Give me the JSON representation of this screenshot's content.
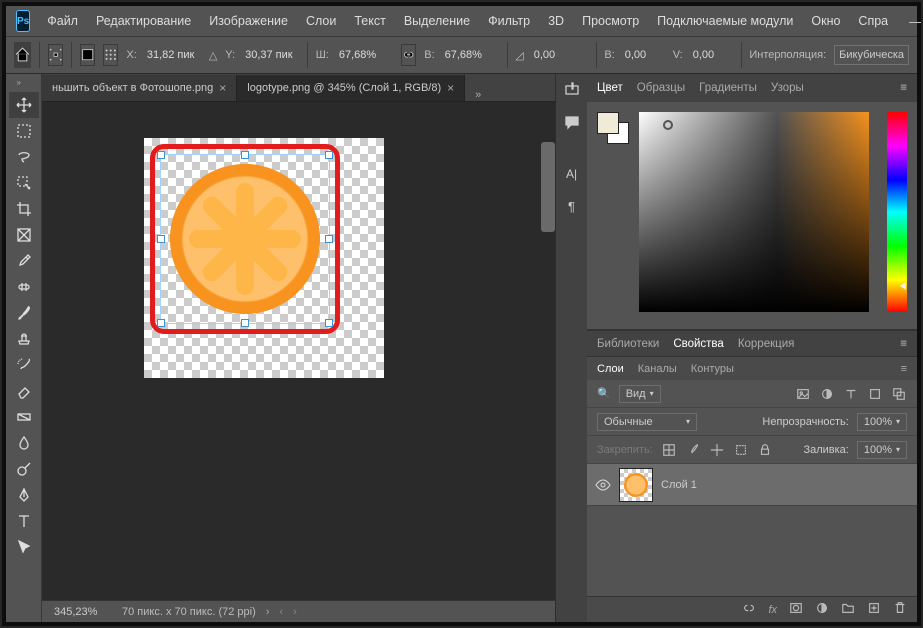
{
  "menu": [
    "Файл",
    "Редактирование",
    "Изображение",
    "Слои",
    "Текст",
    "Выделение",
    "Фильтр",
    "3D",
    "Просмотр",
    "Подключаемые модули",
    "Окно",
    "Спра"
  ],
  "opt": {
    "x_label": "X:",
    "x": "31,82 пик",
    "y_label": "Y:",
    "y": "30,37 пик",
    "w_label": "Ш:",
    "w": "67,68%",
    "h_label": "В:",
    "h": "67,68%",
    "angle": "0,00",
    "hskew_label": "В:",
    "hskew": "0,00",
    "vskew_label": "V:",
    "vskew": "0,00",
    "interp_label": "Интерполяция:",
    "interp": "Бикубическа"
  },
  "tabs": {
    "t1": "ньшить объект в Фотошопе.png",
    "t2": "logotype.png @ 345% (Слой 1, RGB/8)"
  },
  "status": {
    "zoom": "345,23%",
    "info": "70 пикс. x 70 пикс. (72 ppi)"
  },
  "panels": {
    "color_tabs": [
      "Цвет",
      "Образцы",
      "Градиенты",
      "Узоры"
    ],
    "mid_tabs": [
      "Библиотеки",
      "Свойства",
      "Коррекция"
    ],
    "sub_tabs": [
      "Слои",
      "Каналы",
      "Контуры"
    ],
    "filter_label": "Вид",
    "blend": "Обычные",
    "opacity_label": "Непрозрачность:",
    "opacity": "100%",
    "lock_label": "Закрепить:",
    "fill_label": "Заливка:",
    "fill": "100%",
    "layer1": "Слой 1"
  }
}
